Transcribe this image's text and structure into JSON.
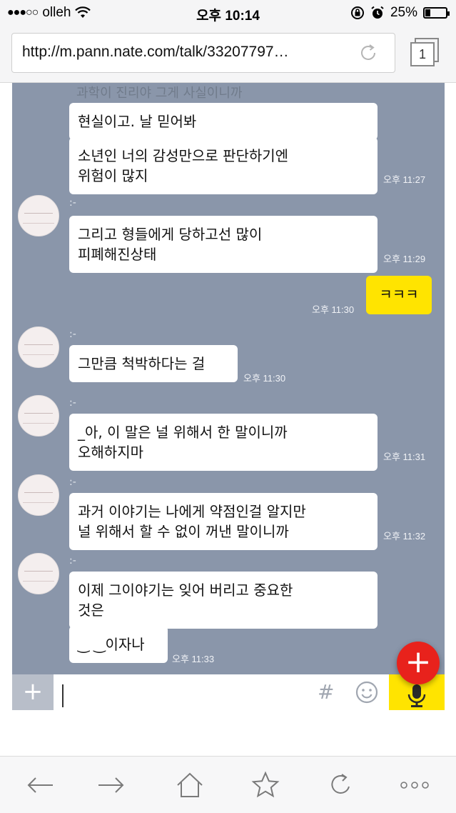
{
  "status_bar": {
    "carrier": "olleh",
    "time": "오후 10:14",
    "battery": "25%",
    "battery_level": 0.25
  },
  "browser": {
    "url": "http://m.pann.nate.com/talk/33207797…",
    "tab_count": "1"
  },
  "chat": {
    "ghost_top_text": "과학이 진리야 그게 사실이니까",
    "sender_name": ":-",
    "messages": [
      {
        "id": "m1",
        "text": "현실이고. 날 믿어봐",
        "time": ""
      },
      {
        "id": "m2",
        "text": "소년인 너의 감성만으로 판단하기엔\n위험이 많지",
        "time": "오후 11:27"
      },
      {
        "id": "m3",
        "text": "그리고 형들에게 당하고선 많이\n피폐해진상태",
        "time": "오후 11:29"
      },
      {
        "id": "m4",
        "text": "ㅋㅋㅋ",
        "time": "오후 11:30",
        "mine": true
      },
      {
        "id": "m5",
        "text": "그만큼 척박하다는 걸",
        "time": "오후 11:30"
      },
      {
        "id": "m6",
        "text": "_아, 이 말은 널 위해서 한 말이니까\n오해하지마",
        "time": "오후 11:31"
      },
      {
        "id": "m7",
        "text": "과거 이야기는 나에게 약점인걸 알지만\n널 위해서 할 수 없이 꺼낸 말이니까",
        "time": "오후 11:32"
      },
      {
        "id": "m8",
        "text": "이제 그이야기는 잊어 버리고 중요한\n것은",
        "time": ""
      },
      {
        "id": "m9",
        "text": "‿ ‿이자나",
        "time": "오후 11:33"
      }
    ]
  },
  "input_bar": {
    "plus": "+",
    "hash": "#"
  },
  "fab": {
    "label": "+"
  },
  "colors": {
    "chat_bg": "#8a96aa",
    "my_bubble": "#ffe400",
    "fab": "#e8221c"
  }
}
